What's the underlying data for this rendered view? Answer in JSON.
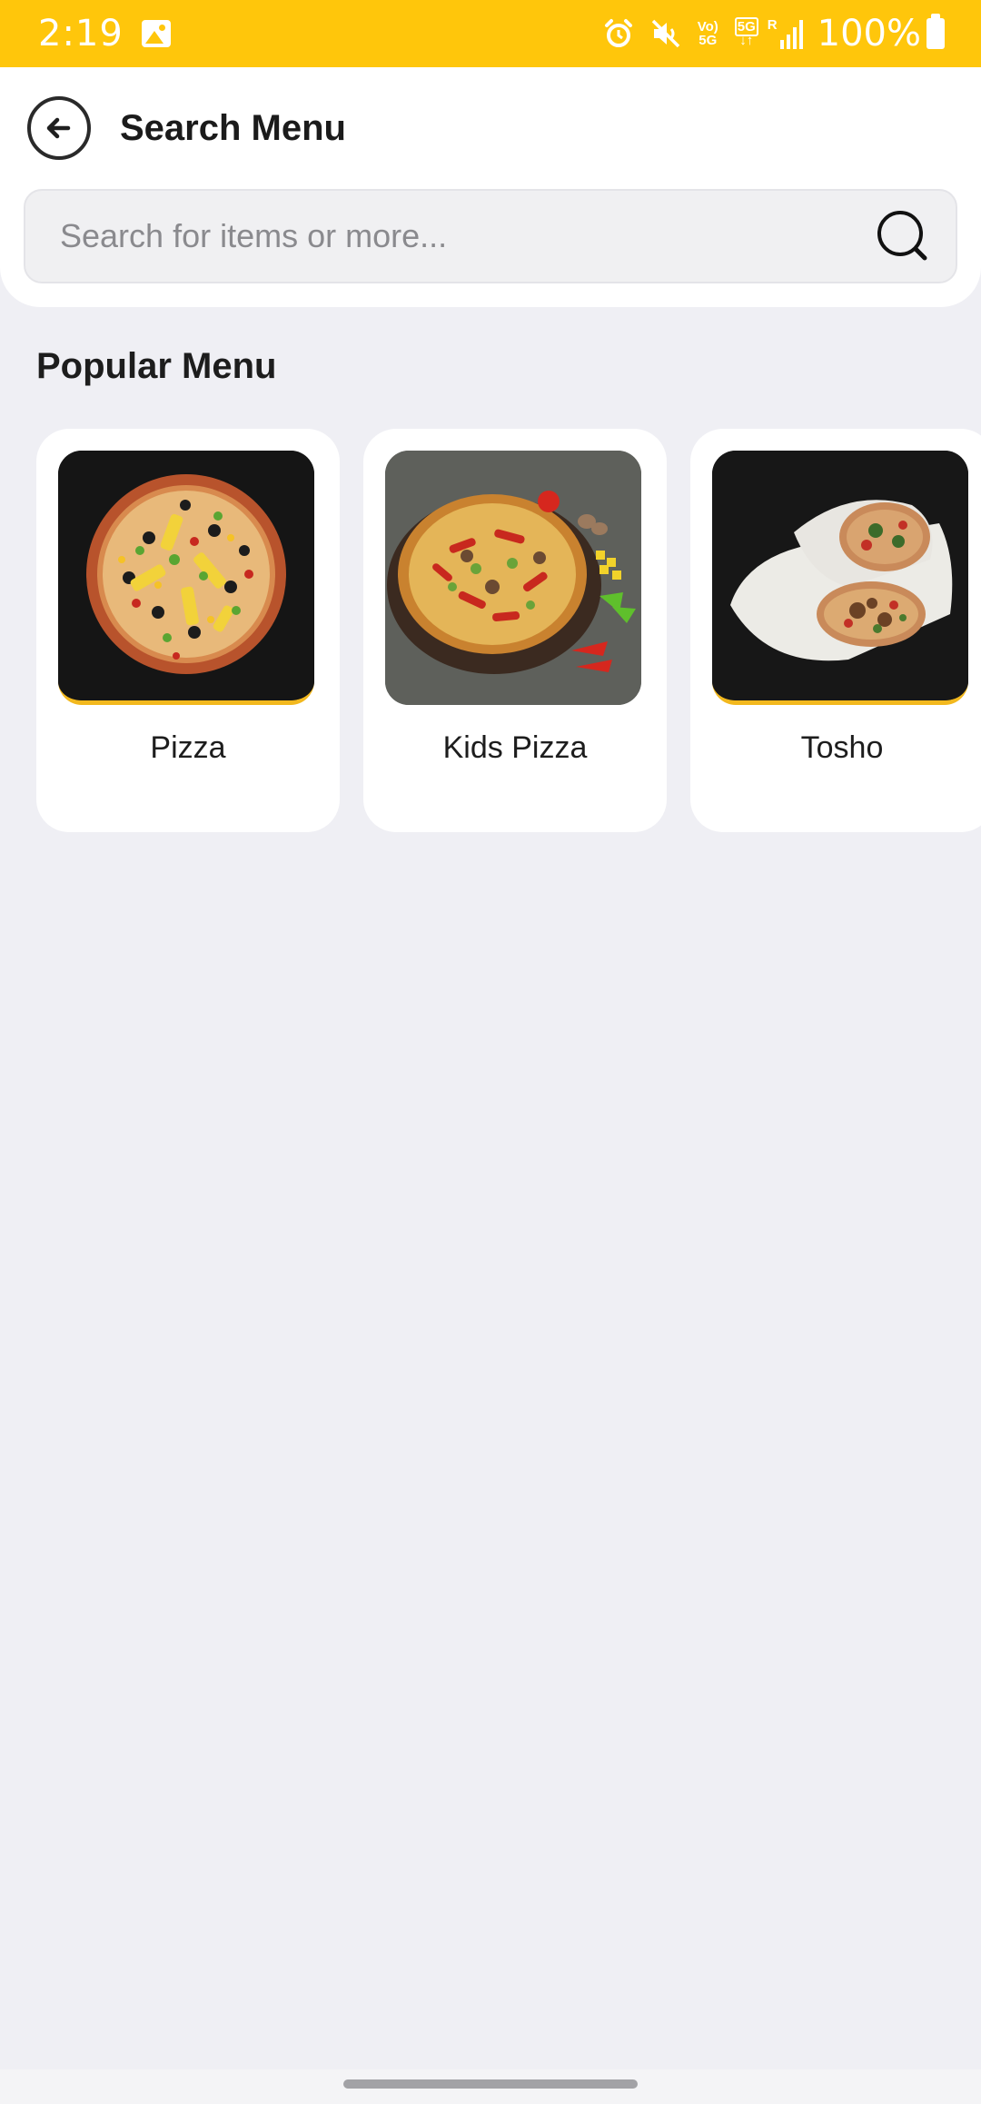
{
  "status_bar": {
    "time": "2:19",
    "volte_line1": "Vo)",
    "volte_line2": "5G",
    "data_line1": "5G",
    "data_line2": "↓↑",
    "roaming": "R",
    "battery": "100%",
    "icons": [
      "gallery-icon",
      "alarm-icon",
      "mute-icon",
      "volte-icon",
      "5g-data-icon",
      "signal-icon",
      "battery-icon"
    ]
  },
  "header": {
    "title": "Search Menu",
    "back_icon": "arrow-left-circle-icon"
  },
  "search": {
    "placeholder": "Search for items or more...",
    "value": "",
    "icon": "search-icon"
  },
  "popular_menu": {
    "title": "Popular Menu",
    "items": [
      {
        "label": "Pizza",
        "image": "pizza-photo"
      },
      {
        "label": "Kids Pizza",
        "image": "kids-pizza-photo"
      },
      {
        "label": "Tosho",
        "image": "tosho-wrap-photo"
      }
    ]
  },
  "colors": {
    "status_bar": "#ffc60b",
    "background": "#efeff4",
    "card": "#ffffff",
    "accent": "#f2b81e"
  }
}
